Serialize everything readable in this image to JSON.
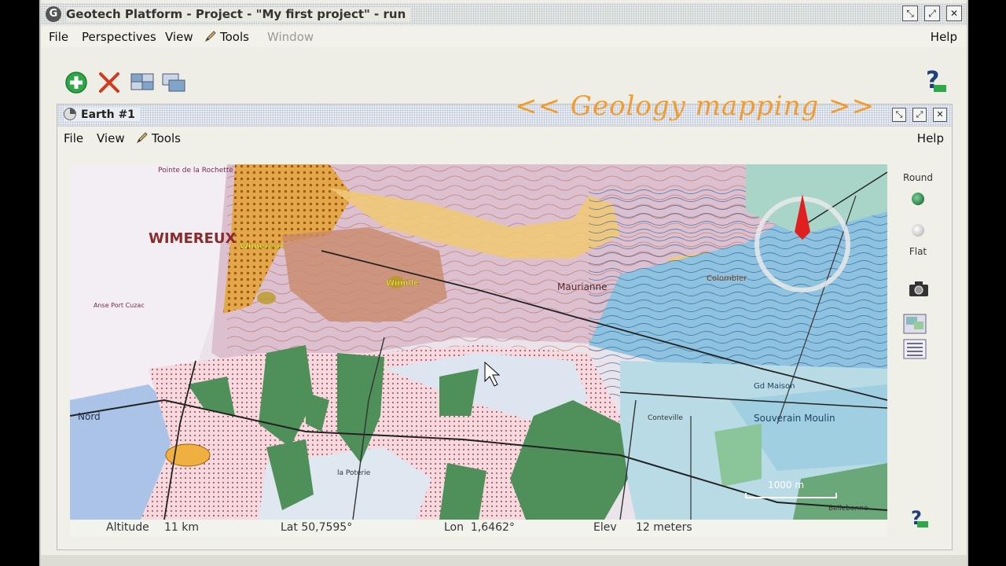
{
  "window": {
    "title": "Geotech Platform - Project - \"My first project\" - run",
    "controls": [
      "minimize-icon",
      "maximize-icon",
      "close-icon"
    ]
  },
  "menubar": {
    "file": "File",
    "perspectives": "Perspectives",
    "view": "View",
    "tools": "Tools",
    "window": "Window",
    "help": "Help"
  },
  "toolbar": {
    "icons": [
      "add-icon",
      "delete-icon",
      "tile-icon",
      "stack-icon",
      "help-icon"
    ]
  },
  "earth": {
    "title": "Earth #1",
    "overlay": "<< Geology mapping >>",
    "menu": {
      "file": "File",
      "view": "View",
      "tools": "Tools",
      "help": "Help"
    }
  },
  "map": {
    "places": {
      "wimereux": "WIMEREUX",
      "wimille": "Wimille",
      "wimereux_small": "Wimereux",
      "pointe": "Pointe de la Rochette",
      "souverain": "Souverain Moulin",
      "maison": "Gd Maison",
      "colombier": "Colombier",
      "maurian": "Maurianne",
      "nord": "Nord",
      "ambleteuse": "Anse Port Cuzac",
      "conteville": "Conteville",
      "bellebonne": "Bellebonne",
      "lacrique": "la Poterie"
    },
    "scale_label": "1000 m",
    "accent_colors": {
      "compass_needle": "#e02020",
      "overlay_text": "#f39c2e"
    }
  },
  "side": {
    "round": "Round",
    "flat": "Flat",
    "icons": [
      "camera-icon",
      "layers-icon",
      "list-icon",
      "help-icon"
    ]
  },
  "status": {
    "altitude_label": "Altitude",
    "altitude_value": "11 km",
    "lat": "Lat 50,7595°",
    "lon": "Lon  1,6462°",
    "elev_label": "Elev",
    "elev_value": "12 meters"
  }
}
